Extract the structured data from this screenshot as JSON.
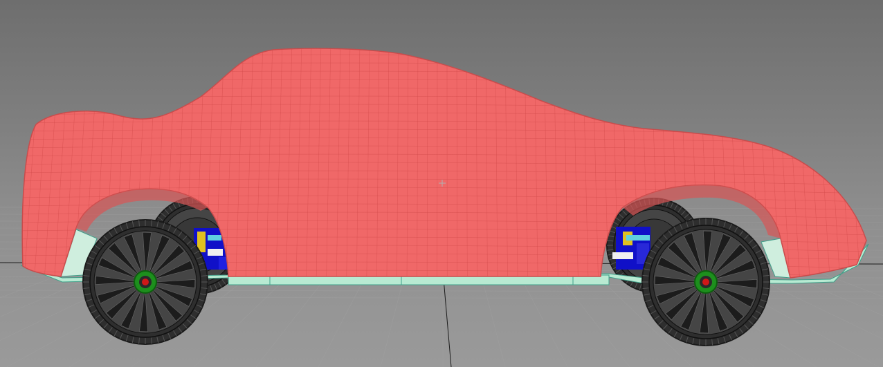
{
  "viewport": {
    "background_top": "#6e6e6e",
    "background_bottom": "#9a9a9a",
    "grid_color": "#a4a4a4",
    "axis_color": "#1a1a1a"
  },
  "model": {
    "body_color": "#f06868",
    "body_wire_color": "#d04848",
    "body_shadow_color": "#c84c4c",
    "chassis_color": "#b8ead2",
    "chassis_edge_color": "#3fa08a",
    "tire_color": "#2e2e2e",
    "tread_color": "#1a1a1a",
    "rim_color": "#454545",
    "hub_color": "#1d8f1d",
    "hub_center_color": "#d01818",
    "suspension_color": "#1010c8",
    "suspension_accent": "#e0c020"
  }
}
